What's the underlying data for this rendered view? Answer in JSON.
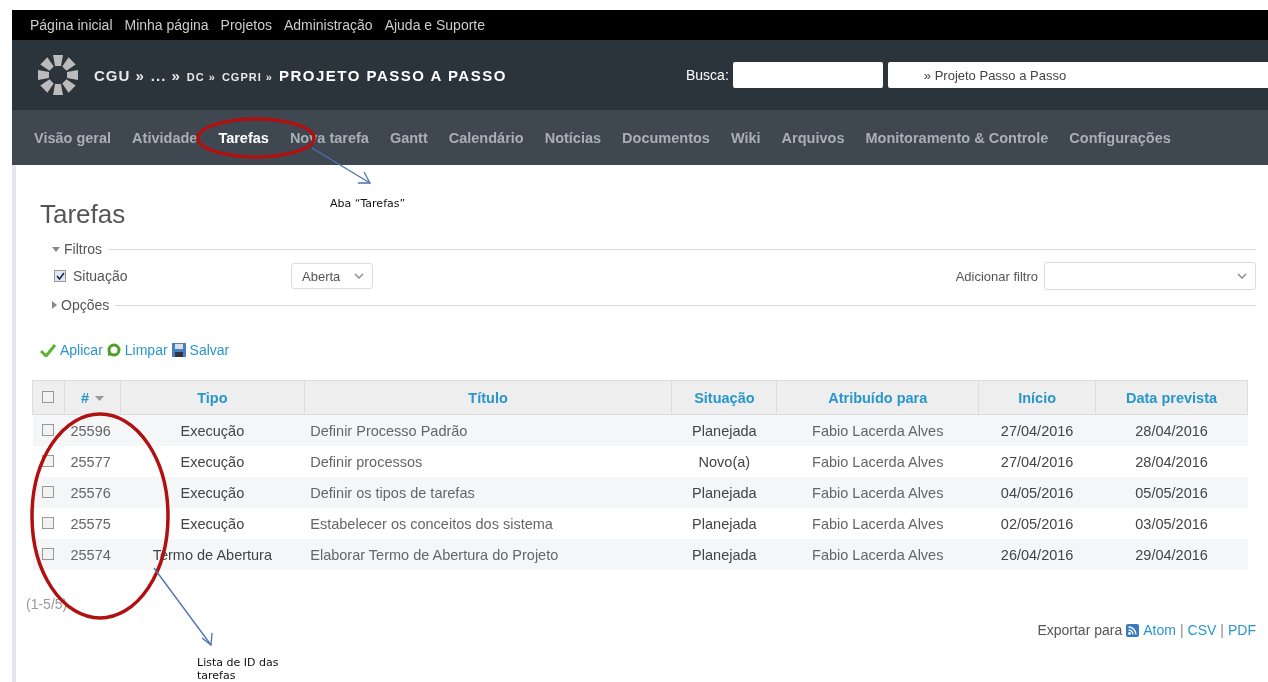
{
  "top_menu": [
    "Página inicial",
    "Minha página",
    "Projetos",
    "Administração",
    "Ajuda e Suporte"
  ],
  "header": {
    "breadcrumb": [
      {
        "text": "CGU »",
        "small": false
      },
      {
        "text": "... »",
        "small": false
      },
      {
        "text": "DC »",
        "small": true
      },
      {
        "text": "CGPRI »",
        "small": true
      }
    ],
    "project_title": "PROJETO PASSO A PASSO",
    "search_label": "Busca:",
    "project_jump": "» Projeto Passo a Passo"
  },
  "tabs": [
    {
      "label": "Visão geral",
      "selected": false
    },
    {
      "label": "Atividade",
      "selected": false
    },
    {
      "label": "Tarefas",
      "selected": true
    },
    {
      "label": "Nova tarefa",
      "selected": false
    },
    {
      "label": "Gantt",
      "selected": false
    },
    {
      "label": "Calendário",
      "selected": false
    },
    {
      "label": "Notícias",
      "selected": false
    },
    {
      "label": "Documentos",
      "selected": false
    },
    {
      "label": "Wiki",
      "selected": false
    },
    {
      "label": "Arquivos",
      "selected": false
    },
    {
      "label": "Monitoramento & Controle",
      "selected": false
    },
    {
      "label": "Configurações",
      "selected": false
    }
  ],
  "page_title": "Tarefas",
  "filters": {
    "legend": "Filtros",
    "expanded": true,
    "filter": {
      "label": "Situação",
      "checked": true,
      "value": "Aberta"
    },
    "add_label": "Adicionar filtro"
  },
  "options": {
    "legend": "Opções",
    "expanded": false
  },
  "actions": [
    {
      "kind": "apply",
      "label": "Aplicar"
    },
    {
      "kind": "clear",
      "label": "Limpar"
    },
    {
      "kind": "save",
      "label": "Salvar"
    }
  ],
  "table": {
    "all_checked": false,
    "columns": [
      "#",
      "Tipo",
      "Título",
      "Situação",
      "Atribuído para",
      "Início",
      "Data prevista"
    ],
    "rows": [
      {
        "checked": false,
        "cells": [
          "25596",
          "Execução",
          "Definir Processo Padrão",
          "Planejada",
          "Fabio Lacerda Alves",
          "27/04/2016",
          "28/04/2016"
        ]
      },
      {
        "checked": false,
        "cells": [
          "25577",
          "Execução",
          "Definir processos",
          "Novo(a)",
          "Fabio Lacerda Alves",
          "27/04/2016",
          "28/04/2016"
        ]
      },
      {
        "checked": false,
        "cells": [
          "25576",
          "Execução",
          "Definir os tipos de tarefas",
          "Planejada",
          "Fabio Lacerda Alves",
          "04/05/2016",
          "05/05/2016"
        ]
      },
      {
        "checked": false,
        "cells": [
          "25575",
          "Execução",
          "Estabelecer os conceitos dos sistema",
          "Planejada",
          "Fabio Lacerda Alves",
          "02/05/2016",
          "03/05/2016"
        ]
      },
      {
        "checked": false,
        "cells": [
          "25574",
          "Termo de Abertura",
          "Elaborar Termo de Abertura do Projeto",
          "Planejada",
          "Fabio Lacerda Alves",
          "26/04/2016",
          "29/04/2016"
        ]
      }
    ]
  },
  "pagination": "(1-5/5)",
  "export": {
    "label": "Exportar para",
    "formats": [
      {
        "kind": "feed",
        "label": "Atom"
      },
      {
        "kind": "plain",
        "label": "CSV"
      },
      {
        "kind": "plain",
        "label": "PDF"
      }
    ],
    "separator": "|"
  },
  "annotations": [
    {
      "text": "Aba “Tarefas”"
    },
    {
      "text": "Lista de ID das tarefas"
    }
  ]
}
